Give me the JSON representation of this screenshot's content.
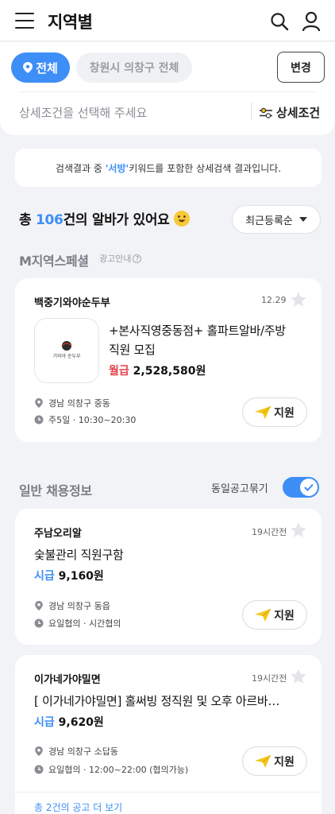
{
  "header": {
    "title": "지역별"
  },
  "filters": {
    "all_label": "전체",
    "region_label": "창원시 의창구 전체",
    "change_label": "변경",
    "placeholder": "상세조건을 선택해 주세요",
    "detail_label": "상세조건"
  },
  "notice": {
    "prefix": "검색결과 중 ",
    "keyword": "'서방'",
    "suffix": " 키워드를 포함한 상세검색 결과입니다."
  },
  "summary": {
    "prefix": "총 ",
    "count": "106",
    "suffix": "건의 알바가 있어요",
    "sort_label": "최근등록순"
  },
  "premium": {
    "title": "M지역스페셜",
    "ad_label": "광고안내",
    "card": {
      "company": "백중기와야순두부",
      "time": "12.29",
      "logo_text": "기와야 순두부",
      "title_line1": "+본사직영중동점+ 홀파트알바/주방",
      "title_line2": "직원 모집",
      "wage_type": "월급",
      "wage_amount": "2,528,580원",
      "location": "경남 의창구 중동",
      "schedule": "주5일 · 10:30~20:30",
      "apply_label": "지원"
    }
  },
  "general": {
    "title": "일반 채용정보",
    "toggle_label": "동일공고묶기",
    "toggle_on": true,
    "items": [
      {
        "company": "주남오리알",
        "time": "19시간전",
        "title": "숯불관리 직원구함",
        "wage_type": "시급",
        "wage_amount": "9,160원",
        "location": "경남 의창구 동읍",
        "schedule": "요일협의 · 시간협의",
        "apply_label": "지원"
      },
      {
        "company": "이가네가야밀면",
        "time": "19시간전",
        "title": "[ 이가네가야밀면] 홀써빙 정직원 및 오후 아르바…",
        "wage_type": "시급",
        "wage_amount": "9,620원",
        "location": "경남 의창구 소답동",
        "schedule": "요일협의 · 12:00~22:00 (협의가능)",
        "apply_label": "지원",
        "more": "총 2건의 공고 더 보기"
      }
    ]
  },
  "colors": {
    "accent": "#3e8ef7",
    "wage_red": "#e5444b",
    "apply_icon": "#f5c518"
  }
}
